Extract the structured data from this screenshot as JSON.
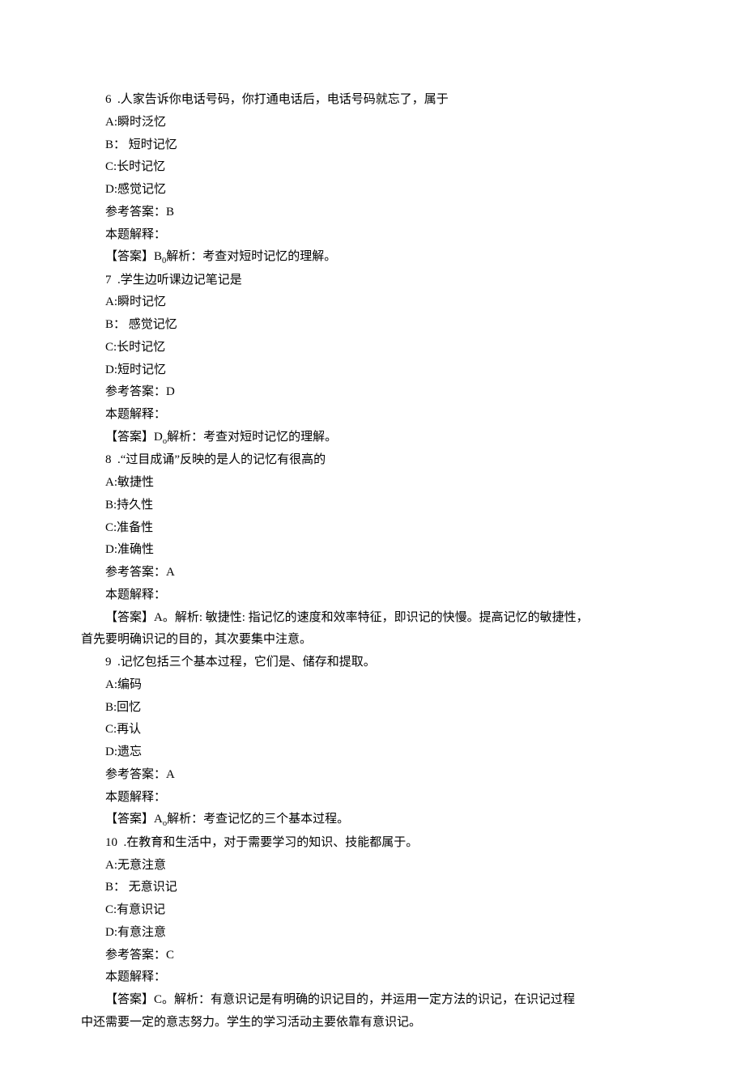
{
  "questions": [
    {
      "num": "6",
      "stem": ".人家告诉你电话号码，你打通电话后，电话号码就忘了，属于",
      "A": "A:瞬时泛忆",
      "B_label": "B：",
      "B_text": "短时记忆",
      "B_full": "",
      "C": "C:长时记忆",
      "D": "D:感觉记忆",
      "ans": "参考答案：B",
      "expl_hdr": "本题解释：",
      "expl_pre": "【答案】B",
      "expl_sub": "0",
      "expl_post": "解析：考查对短时记忆的理解。"
    },
    {
      "num": "7",
      "stem": ".学生边听课边记笔记是",
      "A": "A:瞬时记忆",
      "B_label": "B：",
      "B_text": "感觉记忆",
      "C": "C:长时记忆",
      "D": "D:短时记忆",
      "ans": "参考答案：D",
      "expl_hdr": "本题解释：",
      "expl_pre": "【答案】D",
      "expl_sub": "o",
      "expl_post": "解析：考查对短时记忆的理解。"
    },
    {
      "num": "8",
      "stem": ".“过目成诵”反映的是人的记忆有很高的",
      "A": "A:敏捷性",
      "B_full": "B:持久性",
      "C": "C:准备性",
      "D": "D:准确性",
      "ans": "参考答案：A",
      "expl_hdr": "本题解释：",
      "expl_long1": "【答案】A。解析: 敏捷性: 指记忆的速度和效率特征，即识记的快慢。提高记忆的敏捷性，",
      "expl_long2": "首先要明确识记的目的，其次要集中注意。"
    },
    {
      "num": "9",
      "stem": ".记忆包括三个基本过程，它们是、储存和提取。",
      "A": "A:编码",
      "B_full": "B:回忆",
      "C": "C:再认",
      "D": "D:遗忘",
      "ans": "参考答案：A",
      "expl_hdr": "本题解释：",
      "expl_pre": "【答案】A",
      "expl_sub": "o",
      "expl_post": "解析：考查记忆的三个基本过程。"
    },
    {
      "num": "10",
      "stem": ".在教育和生活中，对于需要学习的知识、技能都属于。",
      "A": "A:无意注意",
      "B_label": "B：",
      "B_text": "无意识记",
      "C": "C:有意识记",
      "D": "D:有意注意",
      "ans": "参考答案：C",
      "expl_hdr": "本题解释：",
      "expl_long1": "【答案】C。解析：有意识记是有明确的识记目的，并运用一定方法的识记，在识记过程",
      "expl_long2": "中还需要一定的意志努力。学生的学习活动主要依靠有意识记。"
    }
  ]
}
